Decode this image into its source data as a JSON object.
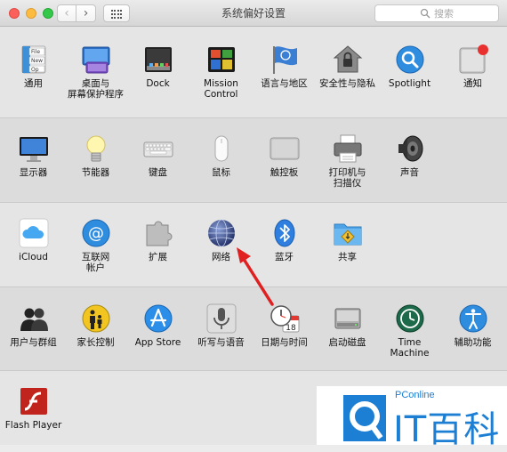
{
  "window": {
    "title": "系统偏好设置"
  },
  "search": {
    "placeholder": "搜索"
  },
  "colors": {
    "accent": "#1c7fd4",
    "arrow": "#e02020"
  },
  "rows": [
    [
      {
        "name": "general",
        "label": "通用",
        "icon": "general-icon"
      },
      {
        "name": "desktop-screensaver",
        "label": "桌面与\n屏幕保护程序",
        "icon": "desktop-icon"
      },
      {
        "name": "dock",
        "label": "Dock",
        "icon": "dock-icon"
      },
      {
        "name": "mission-control",
        "label": "Mission\nControl",
        "icon": "mission-control-icon"
      },
      {
        "name": "language-region",
        "label": "语言与地区",
        "icon": "flag-icon"
      },
      {
        "name": "security-privacy",
        "label": "安全性与隐私",
        "icon": "house-lock-icon"
      },
      {
        "name": "spotlight",
        "label": "Spotlight",
        "icon": "magnifier-icon"
      },
      {
        "name": "notifications",
        "label": "通知",
        "icon": "notifications-icon"
      }
    ],
    [
      {
        "name": "displays",
        "label": "显示器",
        "icon": "display-icon"
      },
      {
        "name": "energy-saver",
        "label": "节能器",
        "icon": "bulb-icon"
      },
      {
        "name": "keyboard",
        "label": "键盘",
        "icon": "keyboard-icon"
      },
      {
        "name": "mouse",
        "label": "鼠标",
        "icon": "mouse-icon"
      },
      {
        "name": "trackpad",
        "label": "触控板",
        "icon": "trackpad-icon"
      },
      {
        "name": "printers-scanners",
        "label": "打印机与\n扫描仪",
        "icon": "printer-icon"
      },
      {
        "name": "sound",
        "label": "声音",
        "icon": "speaker-icon"
      }
    ],
    [
      {
        "name": "icloud",
        "label": "iCloud",
        "icon": "cloud-icon"
      },
      {
        "name": "internet-accounts",
        "label": "互联网\n帐户",
        "icon": "at-icon"
      },
      {
        "name": "extensions",
        "label": "扩展",
        "icon": "puzzle-icon"
      },
      {
        "name": "network",
        "label": "网络",
        "icon": "globe-icon"
      },
      {
        "name": "bluetooth",
        "label": "蓝牙",
        "icon": "bluetooth-icon"
      },
      {
        "name": "sharing",
        "label": "共享",
        "icon": "sharing-folder-icon"
      }
    ],
    [
      {
        "name": "users-groups",
        "label": "用户与群组",
        "icon": "users-icon"
      },
      {
        "name": "parental-controls",
        "label": "家长控制",
        "icon": "parental-icon"
      },
      {
        "name": "app-store",
        "label": "App Store",
        "icon": "app-store-icon"
      },
      {
        "name": "dictation-speech",
        "label": "听写与语音",
        "icon": "microphone-icon"
      },
      {
        "name": "date-time",
        "label": "日期与时间",
        "icon": "clock-calendar-icon"
      },
      {
        "name": "startup-disk",
        "label": "启动磁盘",
        "icon": "disk-icon"
      },
      {
        "name": "time-machine",
        "label": "Time Machine",
        "icon": "time-machine-icon"
      },
      {
        "name": "accessibility",
        "label": "辅助功能",
        "icon": "accessibility-icon"
      }
    ],
    [
      {
        "name": "flash-player",
        "label": "Flash Player",
        "icon": "flash-icon"
      }
    ]
  ],
  "icon_text": {
    "general_file": "File",
    "general_new": "New",
    "general_op": "Op",
    "calendar_day": "18"
  },
  "watermark": {
    "brand": "PConline",
    "title": "IT百科"
  }
}
